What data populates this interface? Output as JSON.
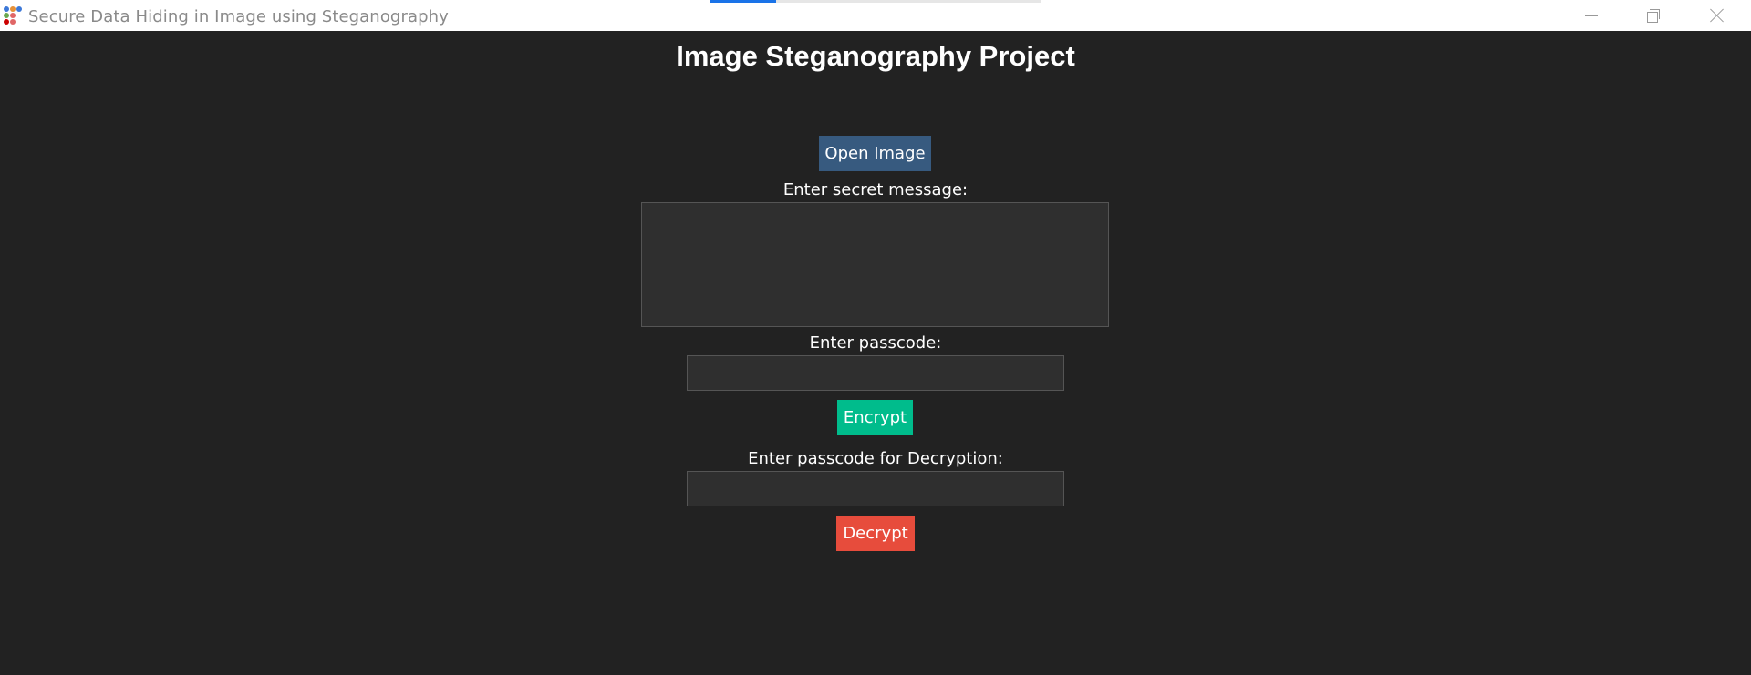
{
  "window": {
    "title": "Secure Data Hiding in Image using Steganography",
    "loading_progress": 0.2
  },
  "icons": {
    "app": "app-icon",
    "minimize": "minimize-icon",
    "restore": "restore-icon",
    "close": "close-icon"
  },
  "colors": {
    "background": "#222222",
    "open_button": "#375a7f",
    "encrypt_button": "#00bc8c",
    "decrypt_button": "#e74c3c",
    "progress": "#1a73e8"
  },
  "main": {
    "heading": "Image Steganography Project",
    "open_button_label": "Open Image",
    "secret_message_label": "Enter secret message:",
    "secret_message_value": "",
    "passcode_label": "Enter passcode:",
    "passcode_value": "",
    "encrypt_button_label": "Encrypt",
    "decrypt_passcode_label": "Enter passcode for Decryption:",
    "decrypt_passcode_value": "",
    "decrypt_button_label": "Decrypt"
  }
}
